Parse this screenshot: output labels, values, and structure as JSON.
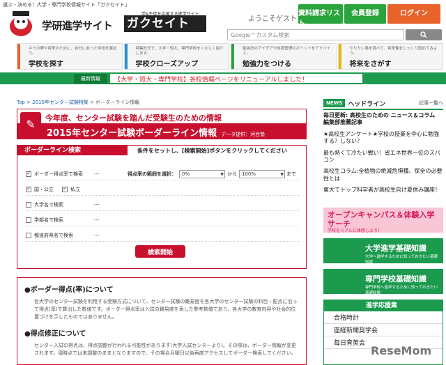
{
  "top_strip": "選ぶ・決める！大学・専門学校情報サイト「ガクセイト」",
  "logo": {
    "main": "学研進学サイト",
    "sub": "学&生徒を応援する進学サイト",
    "brand": "ガクセイト"
  },
  "header": {
    "welcome": "ようこそゲストさん",
    "buttons": [
      "資料請求リスト",
      "会員登録",
      "ログイン"
    ],
    "search_placeholder": "Google™カスタム検索"
  },
  "nav": [
    {
      "desc": "キミの夢や将来のために、自分にあった学校を選ぼう。",
      "label": "学校を探す",
      "color": "#e8632a"
    },
    {
      "desc": "特集形式で、大学・短大、専門学校をくわしく紹介します。",
      "label": "学校クローズアップ",
      "color": "#2b8fd3"
    },
    {
      "desc": "勉強法のアイデアや体調管理のポイントをアドバイス。",
      "label": "勉強力をつける",
      "color": "#2aa43c"
    },
    {
      "desc": "やりたい事を調べて、将来像をじっくり固めてみよう。",
      "label": "将来をさがす",
      "color": "#e5b800"
    }
  ],
  "news_bar": {
    "tag": "最新情報",
    "text": "【大学・短大・専門学校】各校情報ページをリニューアルしました！"
  },
  "breadcrumb": [
    "Top",
    "2015年センター試験特集",
    "ボーダーライン情報"
  ],
  "title": {
    "top": "今年度、センター試験を踏んだ受験生のための情報",
    "main": "2015年センター試験ボーダーライン情報",
    "source": "データ提供：河合塾"
  },
  "form": {
    "heading": "ボーダーライン検索",
    "note": "条件をセットし、[検索開始]ボタンをクリックしてください",
    "rows": [
      {
        "label": "ボーダー得点率で検索",
        "value": "---",
        "checked": true
      },
      {
        "label": "国・公立",
        "checked": true
      },
      {
        "label": "私立",
        "checked": true
      },
      {
        "label": "大学名で検索",
        "value": "---",
        "checked": false
      },
      {
        "label": "学部名で検索",
        "value": "---",
        "checked": false
      },
      {
        "label": "都道府県名で検索",
        "value": "---",
        "checked": false
      }
    ],
    "range_label": "得点率の範囲を選択：",
    "range_from": "0%",
    "range_mid": "から",
    "range_to": "100%",
    "range_end": "まで",
    "submit": "検索開始"
  },
  "info": {
    "h1": "●ボーダー得点(率)について",
    "p1": "各大学のセンター試験を利用する受験方式について、センター試験の難易度を各大学のセンター試験の科目・配点に沿って得点(率)で算出した数値です。ボーダー得点率は入試の難易度を表した参考数値であり、各大学の教育内容や社会的位置づけを示したものではありません。",
    "h2": "●得点修正について",
    "p2": "センター入試の得点は、得点調整が行われる可能性があります(大学入試センターより)。その際は、ボーダー情報が変更されます。現時点では未調整のままとなりますので、その場合月曜日以後再度アクセスしてボーダー検索してください。"
  },
  "sidebar": {
    "badge": "NEWS",
    "title": "ヘッドライン",
    "more": "記事一覧へ",
    "headlines": [
      "毎日更新: 高校生のための ニュース＆コラム　編集部推薦記事",
      "★高校生アンケート★学校の授業を中心に勉強する？しない？",
      "最も熱くて冷たい戦い！省エネ世界一位のスパコン",
      "高校生コラム:全植物の絶滅危惧種、保全の必要性とは",
      "東大でトップ科学者が高校生向け夏休み講座！"
    ],
    "banner1": "オープンキャンパス＆体験入学サーチ",
    "banner1_sub": "学校をリアルに体感しよう！",
    "banner2": "大学進学基礎知識",
    "banner2_sub": "大学へ進学するために知っておきたい基礎知識",
    "banner3": "専門学校基礎知識",
    "banner3_sub": "専門学校へ進学するために知っておきたい基礎知識",
    "sp_title": "進学応援業",
    "sp_items": [
      "合格時計",
      "座経新聞奨学会",
      "毎日育英会"
    ]
  },
  "watermark": "ReseMom"
}
